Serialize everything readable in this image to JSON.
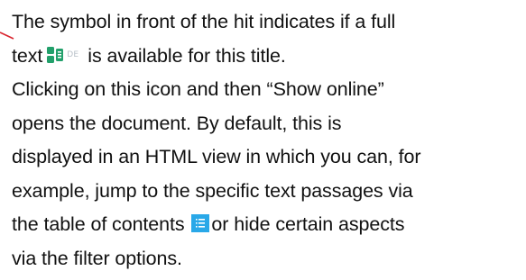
{
  "paragraph": {
    "line1": "The symbol in front of the hit indicates if a full",
    "line2_before": "text",
    "fulltext_icon_label": "DE",
    "line2_after": "is available for this title.",
    "line3": "Clicking on this icon and then “Show online”",
    "line4": "opens the document. By default, this is",
    "line5": "displayed in an HTML view in which you can, for",
    "line6": "example, jump to the specific text passages via",
    "line7_before": "the table of contents",
    "line7_after": "or hide certain aspects",
    "line8": "via the filter options."
  },
  "icons": {
    "fulltext": "fulltext-document-icon",
    "toc": "table-of-contents-icon",
    "pointer": "annotation-pointer-line"
  },
  "colors": {
    "text": "#111111",
    "fulltext_icon": "#22a06b",
    "toc_icon_bg": "#29a8e8",
    "pointer_line": "#d9232d",
    "de_label": "#b8c0c8"
  }
}
